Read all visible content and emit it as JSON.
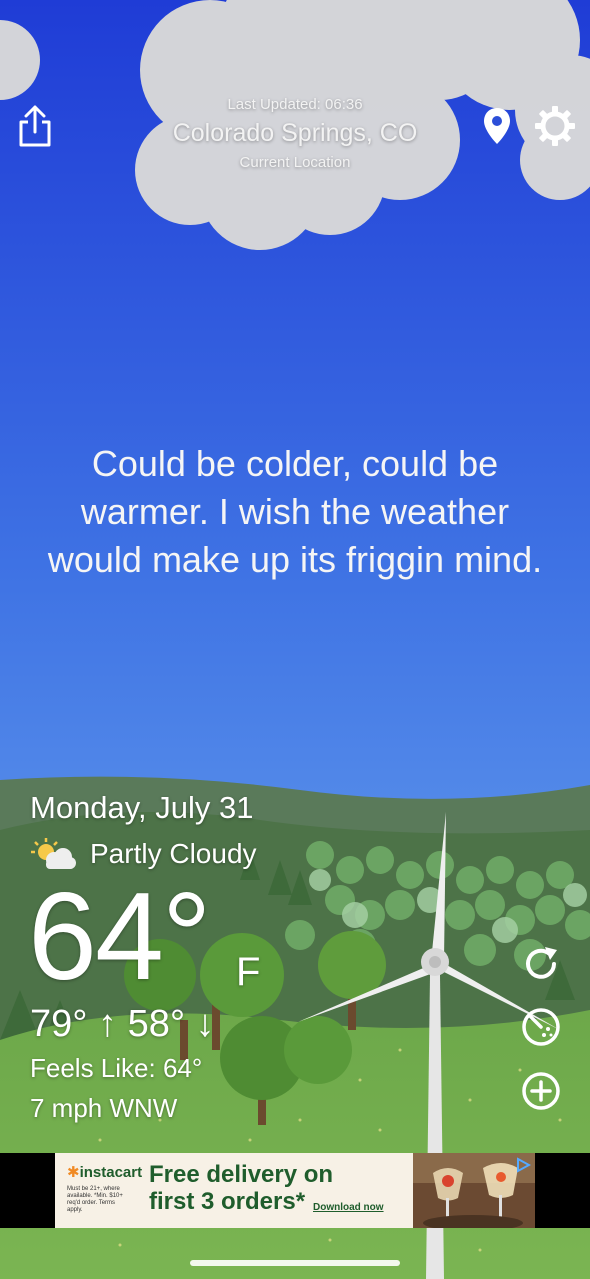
{
  "header": {
    "last_updated": "Last Updated: 06:36",
    "city": "Colorado Springs, CO",
    "location_label": "Current Location"
  },
  "quote": "Could be colder, could be warmer. I wish the weather would make up its friggin mind.",
  "weather": {
    "date": "Monday, July 31",
    "condition": "Partly Cloudy",
    "temperature": "64°",
    "unit": "F",
    "hi_lo": "79° ↑ 58° ↓",
    "feels_like": "Feels Like: 64°",
    "wind": "7 mph WNW"
  },
  "ad": {
    "brand": "instacart",
    "fine_print": "Must be 21+, where available. *Min. $10+ req'd order. Terms apply.",
    "headline_line1": "Free delivery on",
    "headline_line2": "first 3 orders*",
    "cta": "Download now"
  },
  "icons": {
    "share": "share-icon",
    "location": "location-pin-icon",
    "settings": "gear-icon",
    "refresh": "refresh-icon",
    "radar": "radar-icon",
    "add": "add-icon"
  },
  "colors": {
    "sky_top": "#2342d9",
    "sky_bottom": "#78b4f2",
    "grass": "#6ea94a",
    "ad_green": "#1f5d2c"
  }
}
